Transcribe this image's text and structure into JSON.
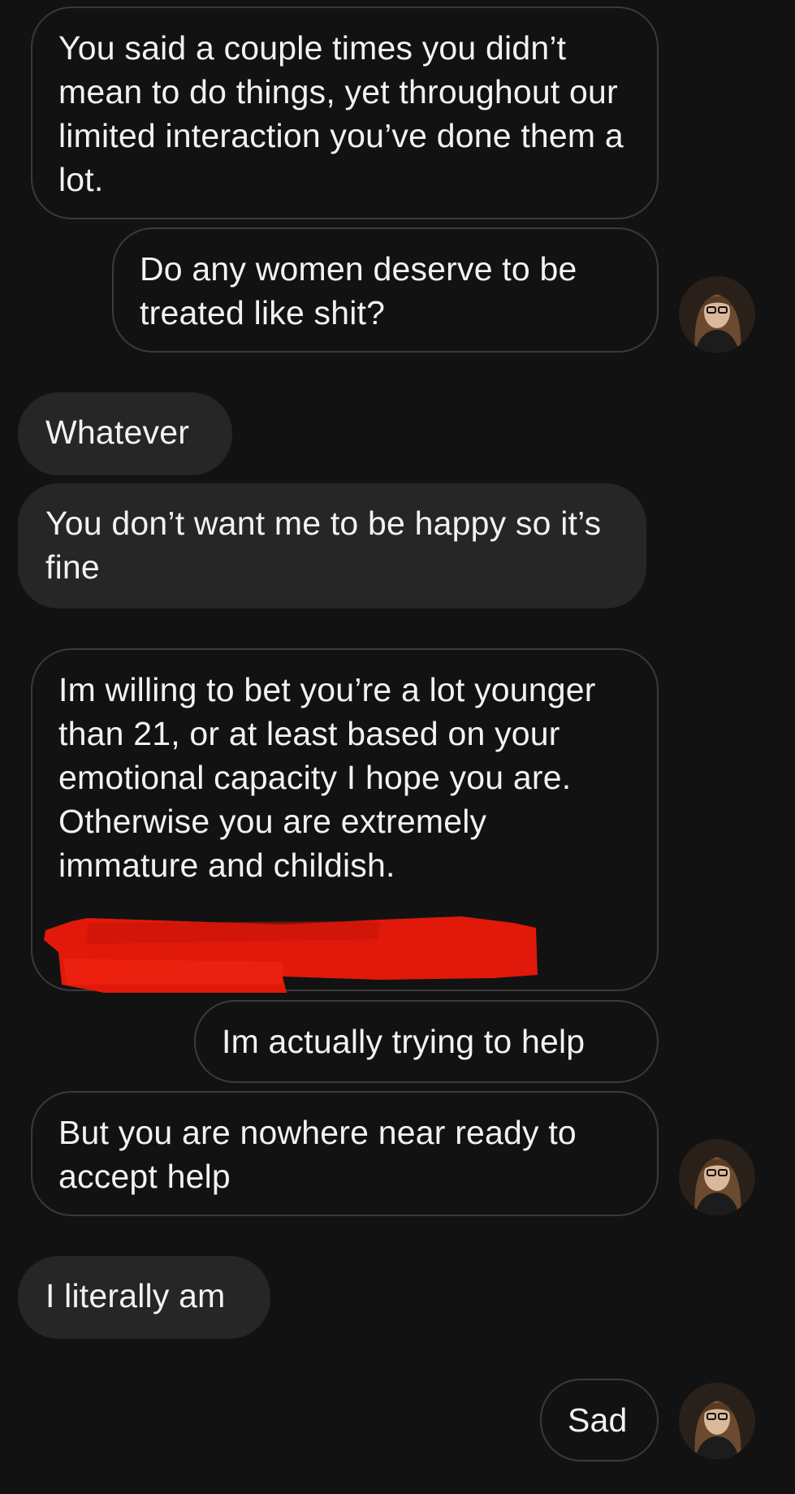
{
  "messages": [
    {
      "text": "You said a couple times you didn’t mean to do things, yet throughout our limited interaction you’ve done them a lot."
    },
    {
      "text": "Do any women deserve to be treated like shit?"
    },
    {
      "text": "Whatever"
    },
    {
      "text": "You don’t want me to be happy so it’s fine"
    },
    {
      "text": "Im willing to bet you’re a lot younger than 21, or at least based on your emotional capacity I hope you are. Otherwise you are extremely immature and childish."
    },
    {
      "text": "Im actually trying to help"
    },
    {
      "text": "But you are nowhere near ready to accept help"
    },
    {
      "text": "I literally am"
    },
    {
      "text": "Sad"
    }
  ],
  "colors": {
    "background": "#121212",
    "incoming_bubble": "#262626",
    "outgoing_border": "#3a3a3a",
    "text": "#f2f2f2",
    "redaction": "#e0190b"
  },
  "icons": {
    "avatar": "profile-photo-avatar"
  }
}
